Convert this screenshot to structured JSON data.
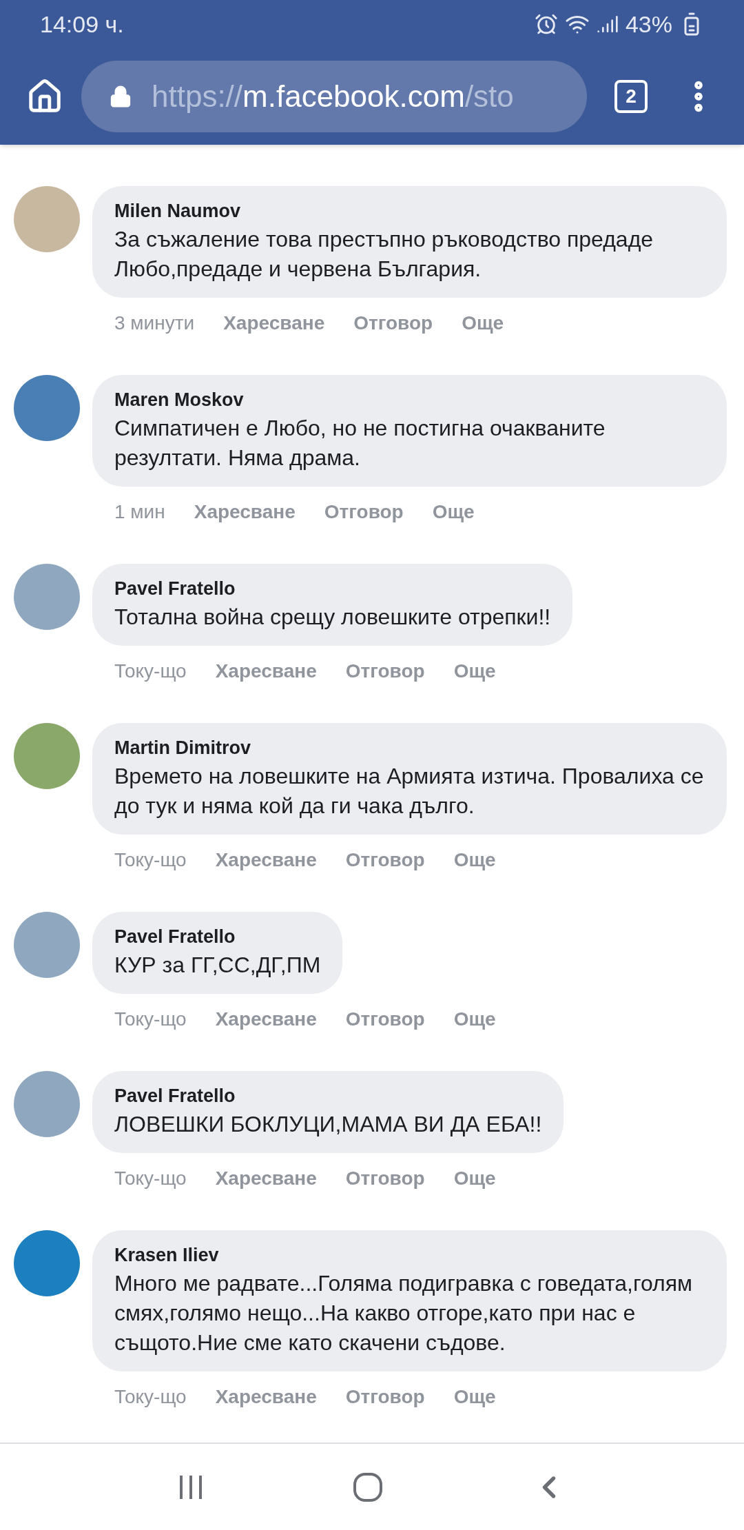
{
  "status_bar": {
    "time": "14:09 ч.",
    "battery": "43%"
  },
  "browser": {
    "url_scheme": "https://",
    "url_host": "m.facebook.com",
    "url_path": "/sto",
    "tab_count": "2"
  },
  "comments": [
    {
      "author": "Milen Naumov",
      "text": "За съжаление това престъпно ръководство предаде Любо,предаде и червена България.",
      "time": "3 минути",
      "actions": [
        "Харесване",
        "Отговор",
        "Още"
      ]
    },
    {
      "author": "Maren Moskov",
      "text": "Симпатичен е Любо, но не постигна очакваните резултати. Няма драма.",
      "time": "1 мин",
      "actions": [
        "Харесване",
        "Отговор",
        "Още"
      ]
    },
    {
      "author": "Pavel Fratello",
      "text": "Тотална война срещу ловешките отрепки!!",
      "time": "Току-що",
      "actions": [
        "Харесване",
        "Отговор",
        "Още"
      ]
    },
    {
      "author": "Martin Dimitrov",
      "text": "Времето на ловешките на Армията изтича. Провалиха се до тук и няма кой да ги чака дълго.",
      "time": "Току-що",
      "actions": [
        "Харесване",
        "Отговор",
        "Още"
      ]
    },
    {
      "author": "Pavel Fratello",
      "text": "КУР за ГГ,СС,ДГ,ПМ",
      "time": "Току-що",
      "actions": [
        "Харесване",
        "Отговор",
        "Още"
      ]
    },
    {
      "author": "Pavel Fratello",
      "text": "ЛОВЕШКИ БОКЛУЦИ,МАМА ВИ ДА ЕБА!!",
      "time": "Току-що",
      "actions": [
        "Харесване",
        "Отговор",
        "Още"
      ]
    },
    {
      "author": "Krasen Iliev",
      "text": "Много ме радвате...Голяма подигравка с говедата,голям смях,голямо нещо...На какво отгоре,като при нас е същото.Ние сме като скачени съдове.",
      "time": "Току-що",
      "actions": [
        "Харесване",
        "Отговор",
        "Още"
      ]
    }
  ]
}
